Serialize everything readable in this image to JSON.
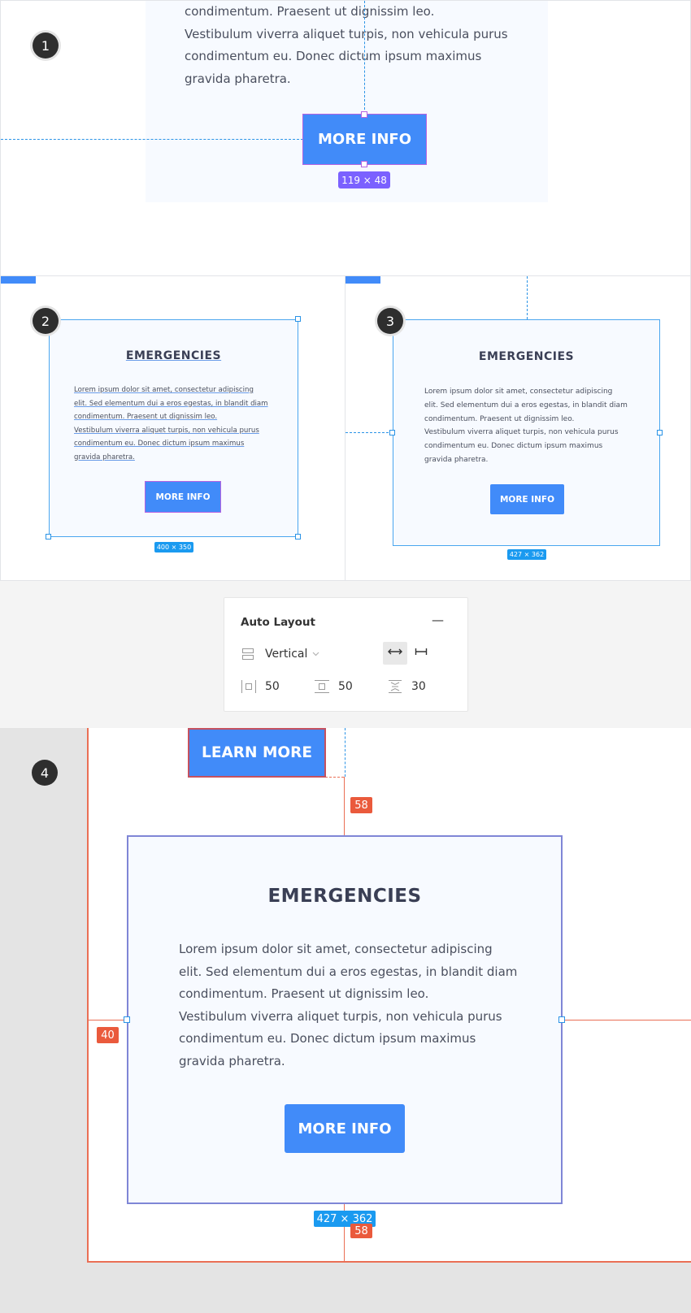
{
  "steps": [
    "1",
    "2",
    "3",
    "4"
  ],
  "card": {
    "title": "EMERGENCIES",
    "paragraph_lines": [
      "Lorem ipsum dolor sit amet, consectetur adipiscing",
      "elit. Sed elementum dui a eros egestas, in blandit diam",
      "condimentum. Praesent ut dignissim leo.",
      "Vestibulum viverra aliquet turpis, non vehicula purus",
      "condimentum eu. Donec dictum ipsum maximus",
      "gravida pharetra."
    ],
    "button_label": "MORE INFO"
  },
  "panel1": {
    "visible_lines": [
      "condimentum. Praesent ut dignissim leo.",
      "Vestibulum viverra aliquet turpis, non vehicula purus",
      "condimentum eu. Donec dictum ipsum maximus",
      "gravida pharetra."
    ],
    "size_label": "119 × 48"
  },
  "panel2": {
    "size_label": "400 × 350"
  },
  "panel3": {
    "size_label": "427 × 362"
  },
  "auto_layout": {
    "title": "Auto Layout",
    "collapse_symbol": "—",
    "direction": "Vertical",
    "padding_horizontal": "50",
    "padding_vertical": "50",
    "spacing": "30"
  },
  "panel4": {
    "learn_more_label": "LEARN MORE",
    "size_label": "427 × 362",
    "spacing_top": "58",
    "spacing_bottom": "58",
    "spacing_left": "40"
  },
  "colors": {
    "accent_blue": "#418bf9",
    "selection_blue": "#2a93e6",
    "size_purple": "#7b61ff",
    "spacing_red": "#ea5a3c",
    "card_bg": "#f7faff",
    "title_text": "#3a3f55"
  }
}
